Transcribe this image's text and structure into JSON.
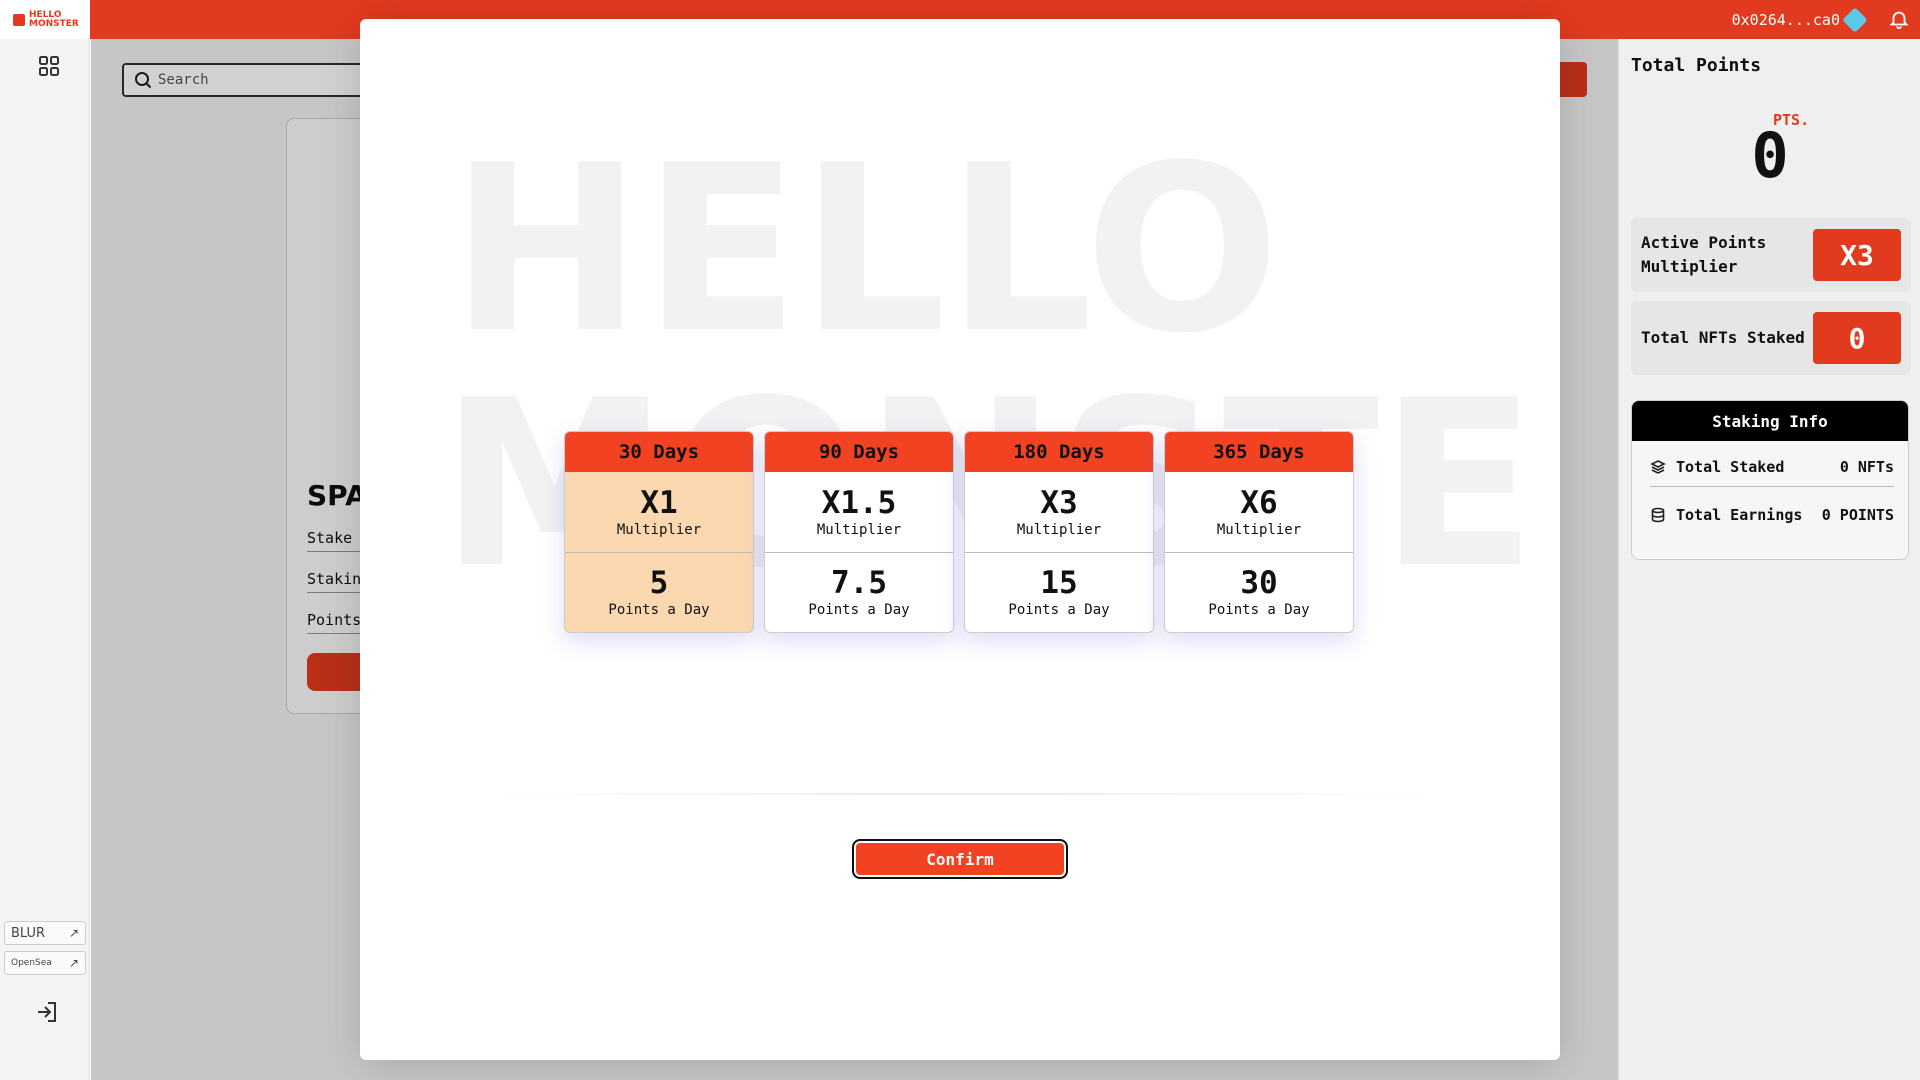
{
  "app": {
    "logo_text": "HELLO MONSTER",
    "wallet_address": "0x0264...ca0"
  },
  "sidebar": {
    "external_links": [
      {
        "label": "BLUR"
      },
      {
        "label": "OpenSea"
      }
    ]
  },
  "background": {
    "search_placeholder": "Search",
    "card_title": "SPAC",
    "rows": [
      "Stake F",
      "Staking",
      "Points"
    ]
  },
  "modal": {
    "watermark_lines": [
      "HELLO",
      "MONSTER"
    ],
    "plans": [
      {
        "period": "30 Days",
        "multiplier": "X1",
        "multiplier_label": "Multiplier",
        "points": "5",
        "points_label": "Points a Day",
        "selected": true
      },
      {
        "period": "90 Days",
        "multiplier": "X1.5",
        "multiplier_label": "Multiplier",
        "points": "7.5",
        "points_label": "Points a Day",
        "selected": false
      },
      {
        "period": "180 Days",
        "multiplier": "X3",
        "multiplier_label": "Multiplier",
        "points": "15",
        "points_label": "Points a Day",
        "selected": false
      },
      {
        "period": "365 Days",
        "multiplier": "X6",
        "multiplier_label": "Multiplier",
        "points": "30",
        "points_label": "Points a Day",
        "selected": false
      }
    ],
    "confirm_label": "Confirm"
  },
  "right_panel": {
    "title": "Total Points",
    "points_value": "0",
    "points_unit": "PTS.",
    "active_multiplier_label_1": "Active Points",
    "active_multiplier_label_2": "Multiplier",
    "active_multiplier_value": "X3",
    "nfts_staked_label": "Total NFTs Staked",
    "nfts_staked_value": "0",
    "staking_info": {
      "title": "Staking Info",
      "total_staked_label": "Total Staked",
      "total_staked_value": "0 NFTs",
      "total_earnings_label": "Total Earnings",
      "total_earnings_value": "0 POINTS"
    }
  },
  "colors": {
    "brand": "#e23a1e",
    "plan_header": "#f24222",
    "plan_selected": "#fbd8b0"
  },
  "icons": [
    "grid-icon",
    "search-icon",
    "bell-icon",
    "diamond-icon",
    "external-link-icon",
    "logout-icon",
    "layers-icon",
    "database-icon"
  ]
}
